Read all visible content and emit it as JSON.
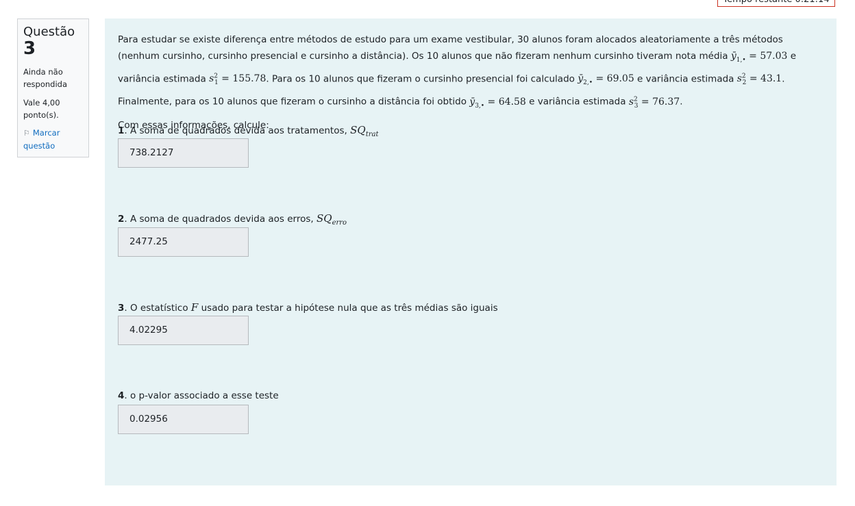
{
  "timer_text": "Tempo restante 0:21:14",
  "info": {
    "label": "Questão",
    "number": "3",
    "state": "Ainda não respondida",
    "grade": "Vale 4,00 ponto(s).",
    "flag_label": "Marcar questão"
  },
  "question": {
    "p1": "Para estudar se existe diferença entre métodos de estudo para um exame vestibular, 30 alunos foram alocados aleatoriamente a três métodos (nenhum cursinho, cursinho presencial e cursinho a distância). Os 10 alunos que não fizeram nenhum cursinho tiveram nota média ",
    "m1": "57.03",
    "p2": " e variância estimada ",
    "v1": "155.78",
    "p3": ". Para os 10 alunos que fizeram o cursinho presencial foi calculado ",
    "m2": "69.05",
    "p4": " e variância estimada ",
    "v2": "43.1",
    "p5": ". Finalmente, para os 10 alunos que fizeram o cursinho a distância foi obtido ",
    "m3": "64.58",
    "p6": " e variância estimada ",
    "v3": "76.37",
    "p7": ".",
    "lead": "Com essas informações, calcule:"
  },
  "subquestions": [
    {
      "num": "1",
      "text": ". A soma de quadrados devida aos tratamentos, ",
      "math_base": "SQ",
      "math_sub": "trat",
      "answer": "738.2127"
    },
    {
      "num": "2",
      "text": ". A soma de quadrados devida aos erros, ",
      "math_base": "SQ",
      "math_sub": "erro",
      "answer": "2477.25"
    },
    {
      "num": "3",
      "text_before": ". O estatístico ",
      "math_base": "F",
      "text_after": " usado para testar a hipótese nula que as três médias são iguais",
      "answer": "4.02295"
    },
    {
      "num": "4",
      "text": ". o p-valor associado a esse teste",
      "answer": "0.02956"
    }
  ]
}
